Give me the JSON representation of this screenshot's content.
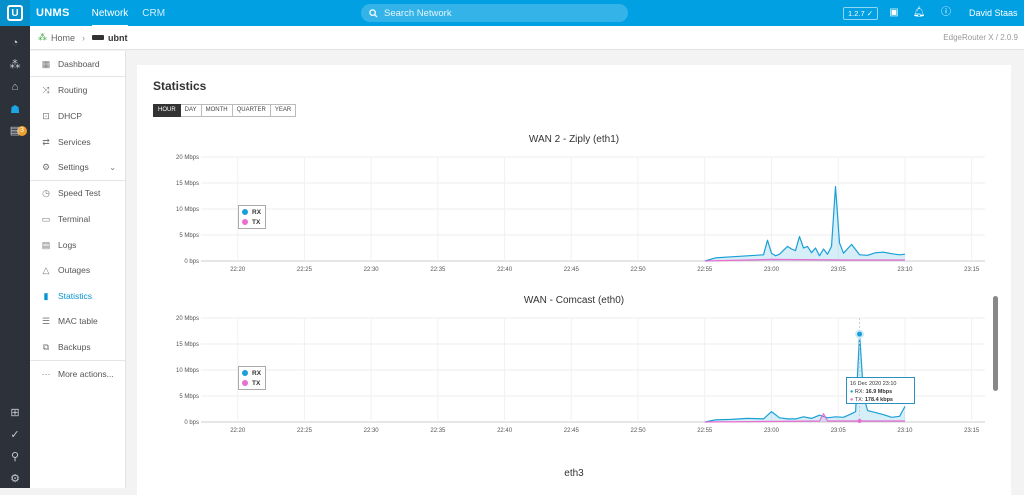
{
  "app": {
    "brand": "UNMS",
    "logo_letter": "U",
    "nav": [
      "Network",
      "CRM"
    ]
  },
  "search": {
    "placeholder": "Search Network"
  },
  "topbar": {
    "version": "1.2.7 ✓",
    "user": "David Staas"
  },
  "leftbar": {
    "badge": "3"
  },
  "breadcrumb": {
    "home": "Home",
    "device": "ubnt",
    "model": "EdgeRouter X / 2.0.9"
  },
  "sidebar": {
    "items": [
      {
        "label": "Dashboard",
        "icon": "dashboard-icon"
      },
      {
        "label": "Routing",
        "icon": "routing-icon"
      },
      {
        "label": "DHCP",
        "icon": "dhcp-icon"
      },
      {
        "label": "Services",
        "icon": "services-icon"
      },
      {
        "label": "Settings",
        "icon": "settings-icon"
      },
      {
        "label": "Speed Test",
        "icon": "speed-test-icon"
      },
      {
        "label": "Terminal",
        "icon": "terminal-icon"
      },
      {
        "label": "Logs",
        "icon": "logs-icon"
      },
      {
        "label": "Outages",
        "icon": "outages-icon"
      },
      {
        "label": "Statistics",
        "icon": "statistics-icon"
      },
      {
        "label": "MAC table",
        "icon": "mac-table-icon"
      },
      {
        "label": "Backups",
        "icon": "backups-icon"
      },
      {
        "label": "More actions...",
        "icon": "more-icon"
      }
    ]
  },
  "page": {
    "title": "Statistics",
    "tabs": [
      "HOUR",
      "DAY",
      "MONTH",
      "QUARTER",
      "YEAR"
    ],
    "active_tab": "HOUR"
  },
  "tooltip": {
    "date": "16 Dec 2020 23:10",
    "rx_label": "RX:",
    "rx_value": "16.9 Mbps",
    "tx_label": "TX:",
    "tx_value": "178.4 kbps"
  },
  "eth3_title": "eth3",
  "colors": {
    "accent": "#01a0e2",
    "rx": "#1a9fd8",
    "tx": "#e86fd0"
  },
  "chart_data": [
    {
      "type": "area",
      "title": "WAN 2 - Ziply (eth1)",
      "x_ticks": [
        "22:20",
        "22:25",
        "22:30",
        "22:35",
        "22:40",
        "22:45",
        "22:50",
        "22:55",
        "23:00",
        "23:05",
        "23:10",
        "23:15"
      ],
      "y_ticks": [
        "0 bps",
        "5 Mbps",
        "10 Mbps",
        "15 Mbps",
        "20 Mbps"
      ],
      "ylim": [
        0,
        20
      ],
      "legend": [
        "RX",
        "TX"
      ],
      "series": [
        {
          "name": "RX",
          "x": [
            22.9167,
            22.93,
            22.95,
            22.97,
            22.98,
            22.99,
            22.995,
            23.0,
            23.005,
            23.01,
            23.02,
            23.025,
            23.03,
            23.035,
            23.04,
            23.045,
            23.05,
            23.055,
            23.06,
            23.065,
            23.07,
            23.075,
            23.08,
            23.085,
            23.09,
            23.1,
            23.11,
            23.12,
            23.13,
            23.14,
            23.15,
            23.16,
            23.1667
          ],
          "values": [
            0,
            0.6,
            0.8,
            1.0,
            1.1,
            1.2,
            4.0,
            1.5,
            1.0,
            1.3,
            2.8,
            2.3,
            2.0,
            4.7,
            2.5,
            2.8,
            1.6,
            2.5,
            1.0,
            2.3,
            1.3,
            2.8,
            14.3,
            3.5,
            1.5,
            3.2,
            1.2,
            1.1,
            1.6,
            1.7,
            1.4,
            1.2,
            1.3
          ]
        },
        {
          "name": "TX",
          "x": [
            22.9167,
            23.0,
            23.1,
            23.1667
          ],
          "values": [
            0,
            0.3,
            0.2,
            0.2
          ]
        }
      ]
    },
    {
      "type": "area",
      "title": "WAN - Comcast (eth0)",
      "x_ticks": [
        "22:20",
        "22:25",
        "22:30",
        "22:35",
        "22:40",
        "22:45",
        "22:50",
        "22:55",
        "23:00",
        "23:05",
        "23:10",
        "23:15"
      ],
      "y_ticks": [
        "0 bps",
        "5 Mbps",
        "10 Mbps",
        "15 Mbps",
        "20 Mbps"
      ],
      "ylim": [
        0,
        20
      ],
      "legend": [
        "RX",
        "TX"
      ],
      "series": [
        {
          "name": "RX",
          "x": [
            22.9167,
            22.93,
            22.95,
            22.97,
            22.99,
            23.0,
            23.01,
            23.02,
            23.03,
            23.04,
            23.05,
            23.06,
            23.07,
            23.08,
            23.09,
            23.1,
            23.105,
            23.11,
            23.115,
            23.12,
            23.13,
            23.14,
            23.15,
            23.16,
            23.1667
          ],
          "values": [
            0,
            0.4,
            0.5,
            0.7,
            0.6,
            2.0,
            0.8,
            0.6,
            0.6,
            1.0,
            0.7,
            1.3,
            0.8,
            1.0,
            0.9,
            1.6,
            2.0,
            16.9,
            5.0,
            2.2,
            1.8,
            1.4,
            0.9,
            1.1,
            3.0
          ]
        },
        {
          "name": "TX",
          "x": [
            22.9167,
            23.06,
            23.065,
            23.07,
            23.11,
            23.1667
          ],
          "values": [
            0,
            0.2,
            1.6,
            0.2,
            0.2,
            0.2
          ]
        }
      ]
    }
  ]
}
